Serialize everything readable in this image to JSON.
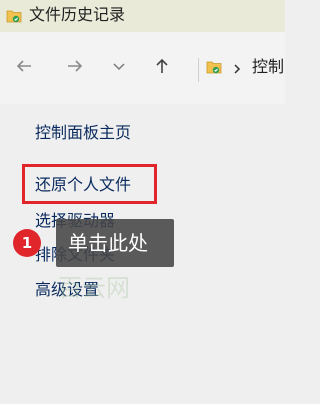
{
  "window": {
    "title": "文件历史记录"
  },
  "toolbar": {
    "back_icon": "arrow-left-icon",
    "forward_icon": "arrow-right-icon",
    "recent_icon": "chevron-down-icon",
    "up_icon": "arrow-up-icon"
  },
  "address_bar": {
    "path_text": "控制"
  },
  "sidebar": {
    "items": [
      {
        "label": "控制面板主页"
      },
      {
        "label": "还原个人文件"
      },
      {
        "label": "选择驱动器"
      },
      {
        "label": "排除文件夹"
      },
      {
        "label": "高级设置"
      }
    ]
  },
  "annotation": {
    "step_number": "1",
    "tooltip_text": "单击此处",
    "highlight_color": "#e0262b"
  },
  "watermark": {
    "text": "百云网"
  }
}
